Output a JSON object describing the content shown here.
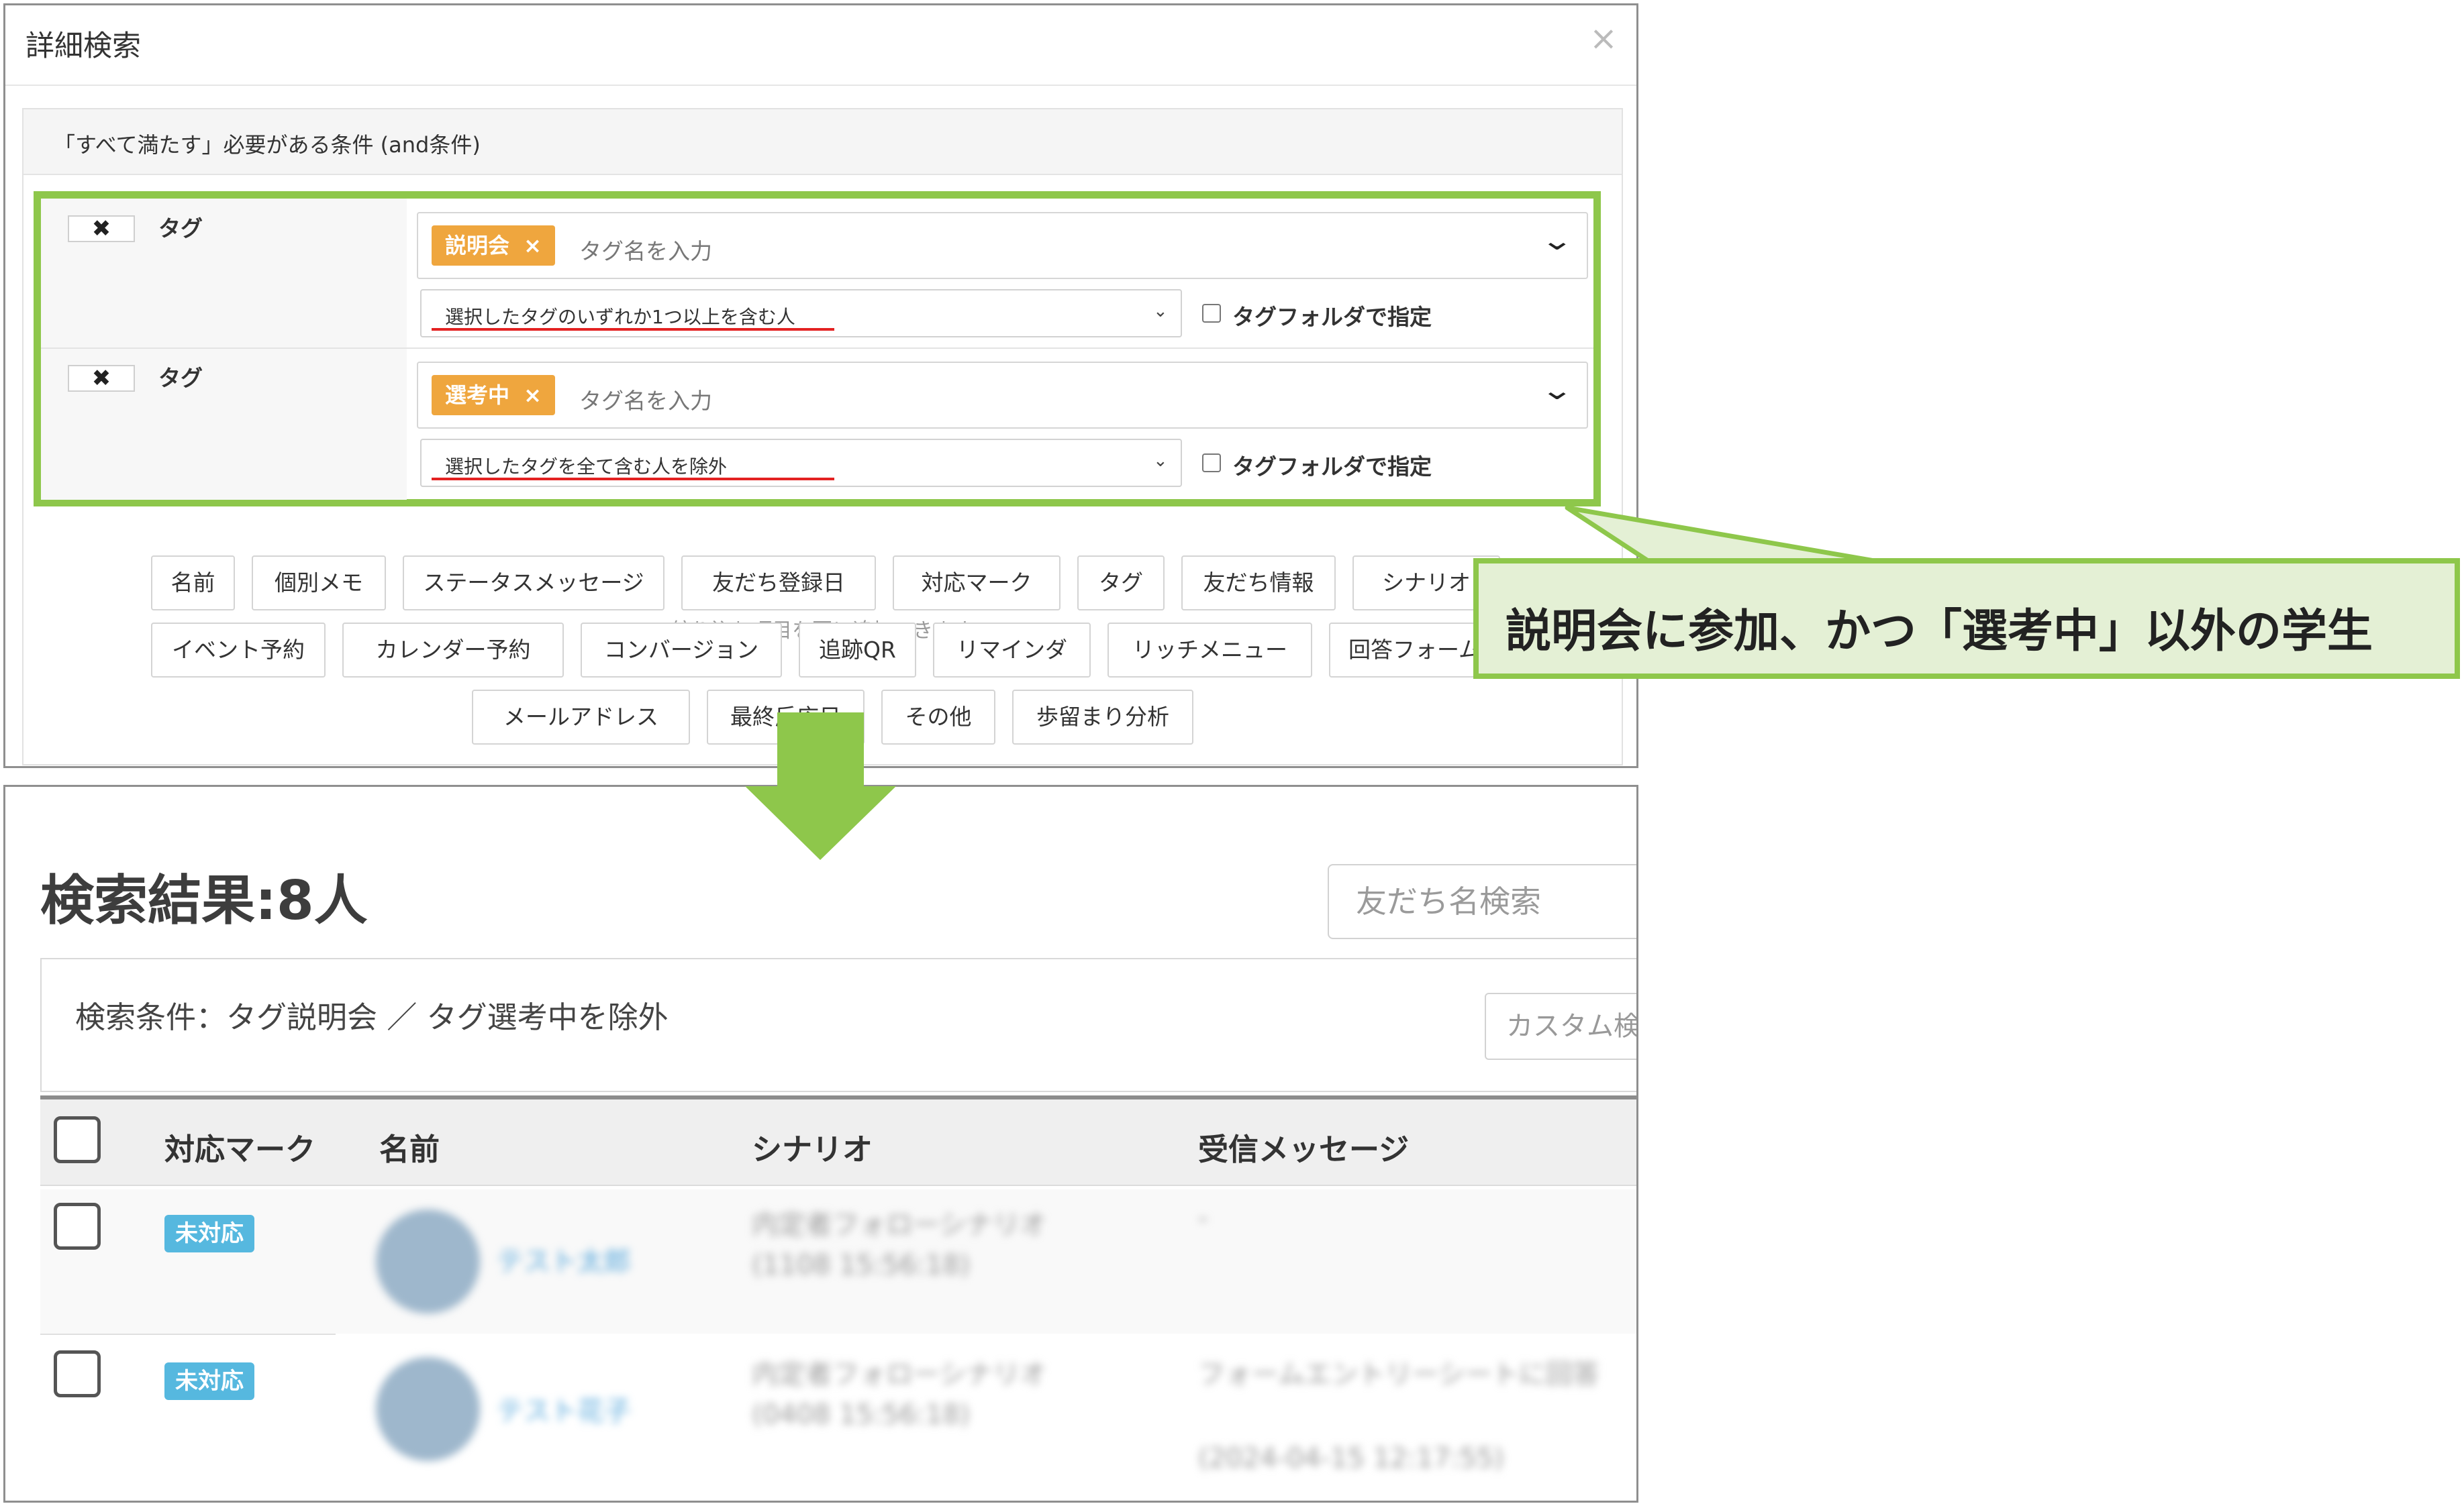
{
  "modal": {
    "title": "詳細検索",
    "close_label": "×",
    "section_title": "「すべて満たす」必要がある条件 (and条件)",
    "conditions": [
      {
        "remove_label": "✖",
        "type_label": "タグ",
        "chip": "説明会",
        "chip_remove": "×",
        "tag_placeholder": "タグ名を入力",
        "match_mode": "選択したタグのいずれか1つ以上を含む人",
        "folder_label": "タグフォルダで指定"
      },
      {
        "remove_label": "✖",
        "type_label": "タグ",
        "chip": "選考中",
        "chip_remove": "×",
        "tag_placeholder": "タグ名を入力",
        "match_mode": "選択したタグを全て含む人を除外",
        "folder_label": "タグフォルダで指定"
      }
    ],
    "add_hint": "絞り込む項目を更に追加できます",
    "filter_buttons_row1": [
      "名前",
      "個別メモ",
      "ステータスメッセージ",
      "友だち登録日",
      "対応マーク",
      "タグ",
      "友だち情報",
      "シナリオ"
    ],
    "filter_buttons_row2": [
      "イベント予約",
      "カレンダー予約",
      "コンバージョン",
      "追跡QR",
      "リマインダ",
      "リッチメニュー",
      "回答フォーム"
    ],
    "filter_buttons_row3": [
      "メールアドレス",
      "最終反応日",
      "その他",
      "歩留まり分析"
    ]
  },
  "callout": {
    "text": "説明会に参加、かつ「選考中」以外の学生"
  },
  "results": {
    "title": "検索結果:8人",
    "friend_search_placeholder": "友だち名検索",
    "conditions_text": "検索条件：タグ説明会 ／ タグ選考中を除外",
    "custom_button": "カスタム検索",
    "columns": [
      "対応マーク",
      "名前",
      "シナリオ",
      "受信メッセージ"
    ],
    "rows": [
      {
        "status": "未対応",
        "name": "テスト太郎",
        "scenario_line1": "内定者フォローシナリオ",
        "scenario_line2": "(1108 15:56:18)",
        "message_line1": "-",
        "message_line2": ""
      },
      {
        "status": "未対応",
        "name": "テスト花子",
        "scenario_line1": "内定者フォローシナリオ",
        "scenario_line2": "(0408 15:56:18)",
        "message_line1": "フォームエントリーシートに回答",
        "message_line2": "(2024-04-15 12:17:55)"
      }
    ]
  },
  "colors": {
    "highlight_green": "#8ec74b",
    "callout_bg": "#e4f0d5",
    "tag_chip": "#efa63e",
    "status_badge": "#56b8df",
    "underline_red": "#e32222"
  }
}
